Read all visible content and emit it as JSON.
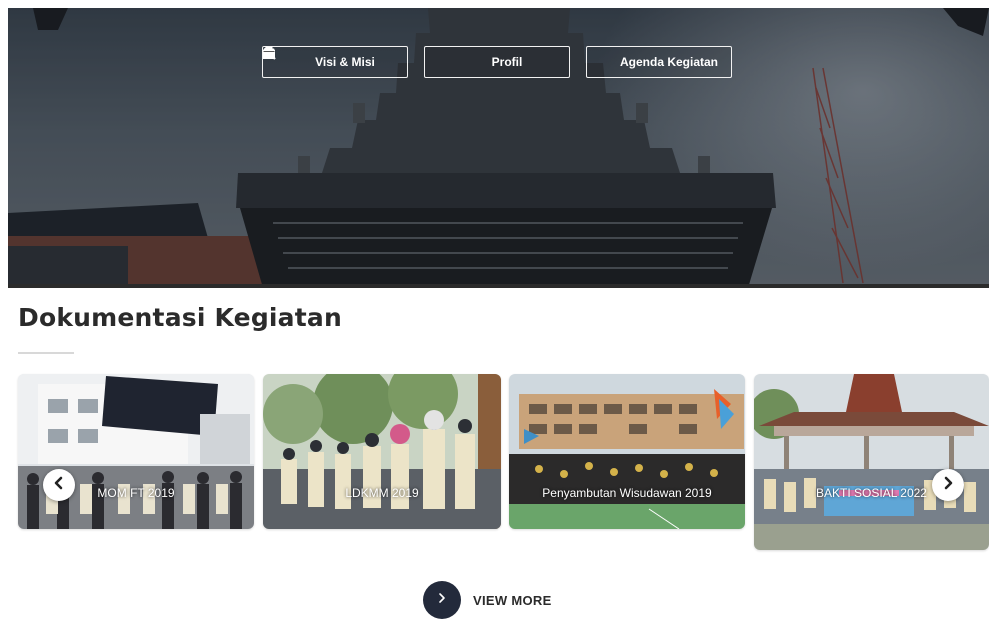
{
  "hero": {
    "buttons": [
      {
        "label": "Visi & Misi",
        "icon": "search-icon"
      },
      {
        "label": "Profil",
        "icon": "building-icon"
      },
      {
        "label": "Agenda Kegiatan",
        "icon": "calendar-icon"
      }
    ]
  },
  "section": {
    "title": "Dokumentasi Kegiatan"
  },
  "gallery": {
    "items": [
      {
        "caption": "MOM FT 2019"
      },
      {
        "caption": "LDKMM 2019"
      },
      {
        "caption": "Penyambutan Wisudawan 2019"
      },
      {
        "caption": "BAKTI SOSIAL 2022"
      }
    ],
    "prev_icon": "chevron-left-icon",
    "next_icon": "chevron-right-icon"
  },
  "view_more": {
    "label": "VIEW MORE",
    "icon": "chevron-right-icon"
  },
  "colors": {
    "view_more_circle": "#232a3b",
    "title_text": "#2b2b2b"
  }
}
